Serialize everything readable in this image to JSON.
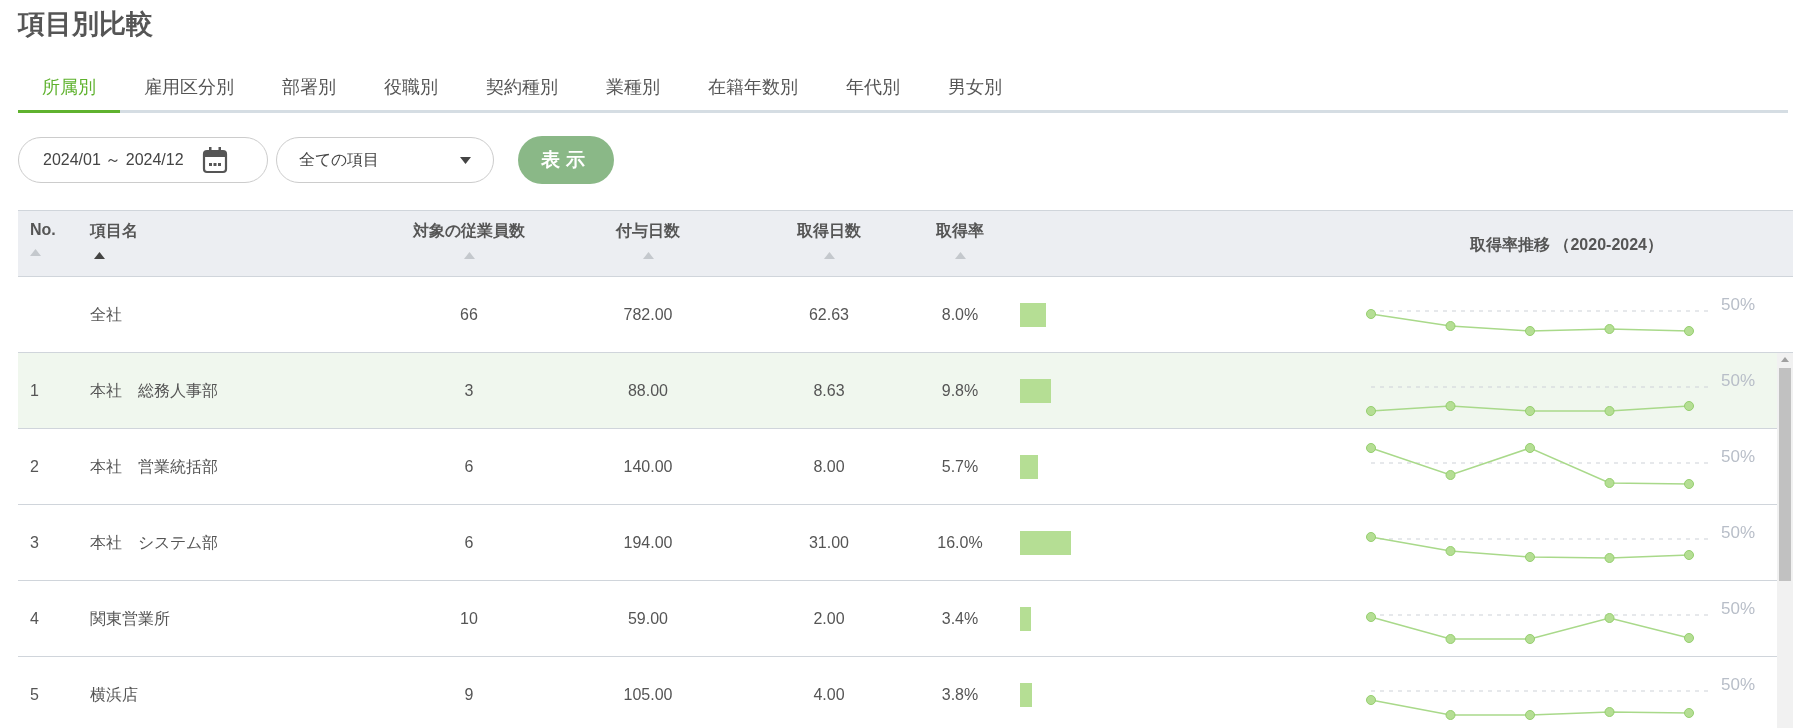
{
  "title": "項目別比較",
  "tabs": [
    {
      "label": "所属別",
      "selected": true
    },
    {
      "label": "雇用区分別",
      "selected": false
    },
    {
      "label": "部署別",
      "selected": false
    },
    {
      "label": "役職別",
      "selected": false
    },
    {
      "label": "契約種別",
      "selected": false
    },
    {
      "label": "業種別",
      "selected": false
    },
    {
      "label": "在籍年数別",
      "selected": false
    },
    {
      "label": "年代別",
      "selected": false
    },
    {
      "label": "男女別",
      "selected": false
    }
  ],
  "filters": {
    "date_range": "2024/01 ～ 2024/12",
    "category": "全ての項目",
    "submit": "表示"
  },
  "table": {
    "columns": [
      {
        "label": "No.",
        "kind": "sortable",
        "sorted": false
      },
      {
        "label": "項目名",
        "kind": "sortable",
        "sorted": true
      },
      {
        "label": "対象の従業員数",
        "kind": "sortable",
        "sorted": false
      },
      {
        "label": "付与日数",
        "kind": "sortable",
        "sorted": false
      },
      {
        "label": "取得日数",
        "kind": "sortable",
        "sorted": false
      },
      {
        "label": "取得率",
        "kind": "sortable",
        "sorted": false
      },
      {
        "label": "取得率推移 （2020-2024）",
        "kind": "trend"
      }
    ],
    "rows": [
      {
        "name": "全社",
        "employees": "66",
        "granted": "782.00",
        "taken": "62.63",
        "rate": "8.0%",
        "trend_reference": "50%",
        "selected": false
      },
      {
        "no": "1",
        "name": "本社　総務人事部",
        "employees": "3",
        "granted": "88.00",
        "taken": "8.63",
        "rate": "9.8%",
        "trend_reference": "50%",
        "selected": true
      },
      {
        "no": "2",
        "name": "本社　営業統括部",
        "employees": "6",
        "granted": "140.00",
        "taken": "8.00",
        "rate": "5.7%",
        "trend_reference": "50%",
        "selected": false
      },
      {
        "no": "3",
        "name": "本社　システム部",
        "employees": "6",
        "granted": "194.00",
        "taken": "31.00",
        "rate": "16.0%",
        "trend_reference": "50%",
        "selected": false
      },
      {
        "no": "4",
        "name": "関東営業所",
        "employees": "10",
        "granted": "59.00",
        "taken": "2.00",
        "rate": "3.4%",
        "trend_reference": "50%",
        "selected": false
      },
      {
        "no": "5",
        "name": "横浜店",
        "employees": "9",
        "granted": "105.00",
        "taken": "4.00",
        "rate": "3.8%",
        "trend_reference": "50%",
        "selected": false
      }
    ]
  }
}
